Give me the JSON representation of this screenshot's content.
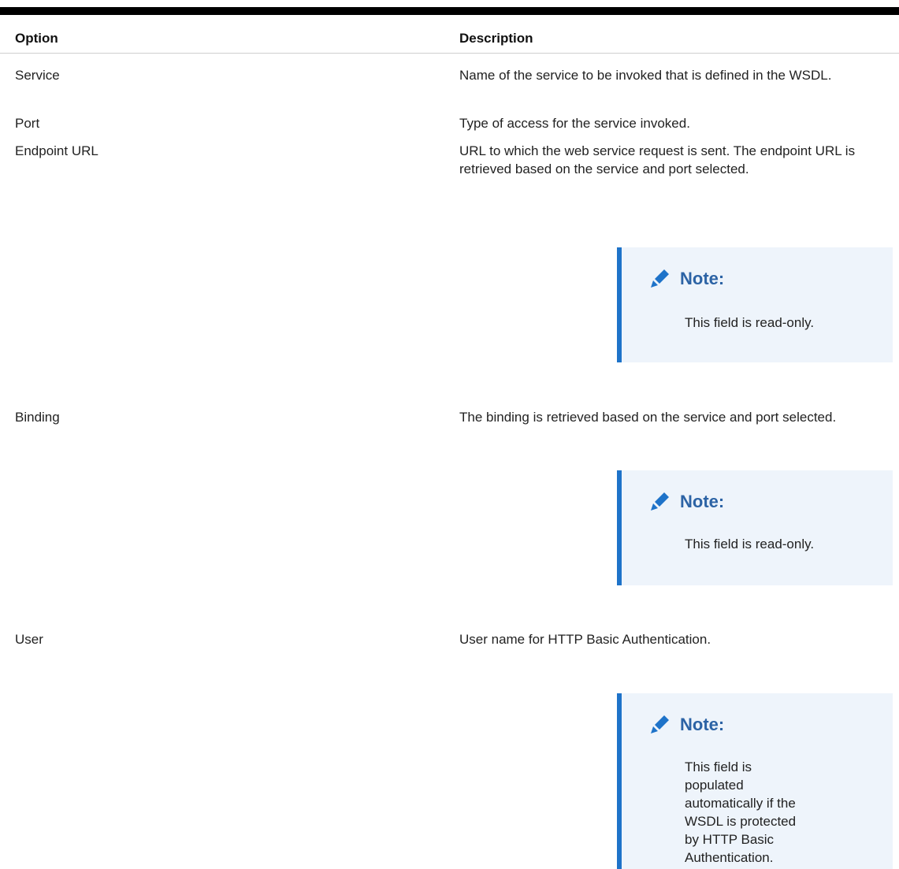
{
  "table": {
    "headers": {
      "option": "Option",
      "description": "Description"
    },
    "rows": [
      {
        "option": "Service",
        "description": "Name of the service to be invoked that is defined in the WSDL."
      },
      {
        "option": "Port",
        "description": "Type of access for the service invoked."
      },
      {
        "option": "Endpoint URL",
        "description": "URL to which the web service request is sent. The endpoint URL is retrieved based on the service and port selected.",
        "note": {
          "icon": "pencil-icon",
          "title": "Note:",
          "text": "This field is read-only."
        }
      },
      {
        "option": "Binding",
        "description": "The binding is retrieved based on the service and port selected.",
        "note": {
          "icon": "pencil-icon",
          "title": "Note:",
          "text": "This field is read-only."
        }
      },
      {
        "option": "User",
        "description": "User name for HTTP Basic Authentication.",
        "note": {
          "icon": "pencil-icon",
          "title": "Note:",
          "text": "This field is populated automatically if the WSDL is protected by HTTP Basic Authentication."
        }
      }
    ]
  },
  "colors": {
    "note_accent": "#1e73c9",
    "note_background": "#eef4fb",
    "note_title": "#2c63a5"
  }
}
